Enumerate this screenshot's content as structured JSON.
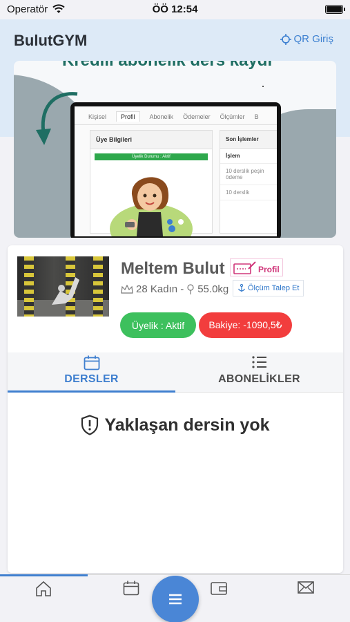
{
  "status_bar": {
    "carrier": "Operatör",
    "time": "ÖÖ 12:54"
  },
  "header": {
    "title": "BulutGYM",
    "qr_label": "QR Giriş"
  },
  "banner": {
    "caption": "Kredili abonelik ders kaydı",
    "tabs": [
      "Kişisel",
      "Profil",
      "Abonelik",
      "Ödemeler",
      "Ölçümler",
      "B"
    ],
    "left_panel_title": "Üye Bilgileri",
    "membership_badge": "Üyelik Durumu : Aktif",
    "right_panel_title": "Son İşlemler",
    "right_panel_header": "İşlem",
    "right_rows": [
      "10 derslik peşin ödeme",
      "10 derslik"
    ]
  },
  "profile": {
    "name": "Meltem Bulut",
    "profile_link": "Profil",
    "age_gender": "28 Kadın -",
    "weight": "55.0kg",
    "measure_button": "Ölçüm Talep Et",
    "membership_pill": "Üyelik : Aktif",
    "balance_pill": "Bakiye: -1090,5₺"
  },
  "tabs": [
    {
      "label": "DERSLER",
      "icon": "calendar-icon",
      "active": true
    },
    {
      "label": "ABONELİKLER",
      "icon": "list-icon",
      "active": false
    }
  ],
  "empty_state": "Yaklaşan dersin yok",
  "bottom_nav": [
    "home-icon",
    "calendar-icon",
    "menu-icon",
    "wallet-icon",
    "mail-icon"
  ],
  "colors": {
    "accent": "#3f7fcf",
    "active_green": "#3dc05d",
    "balance_red": "#f23d3d",
    "profile_pink": "#d0367a"
  }
}
